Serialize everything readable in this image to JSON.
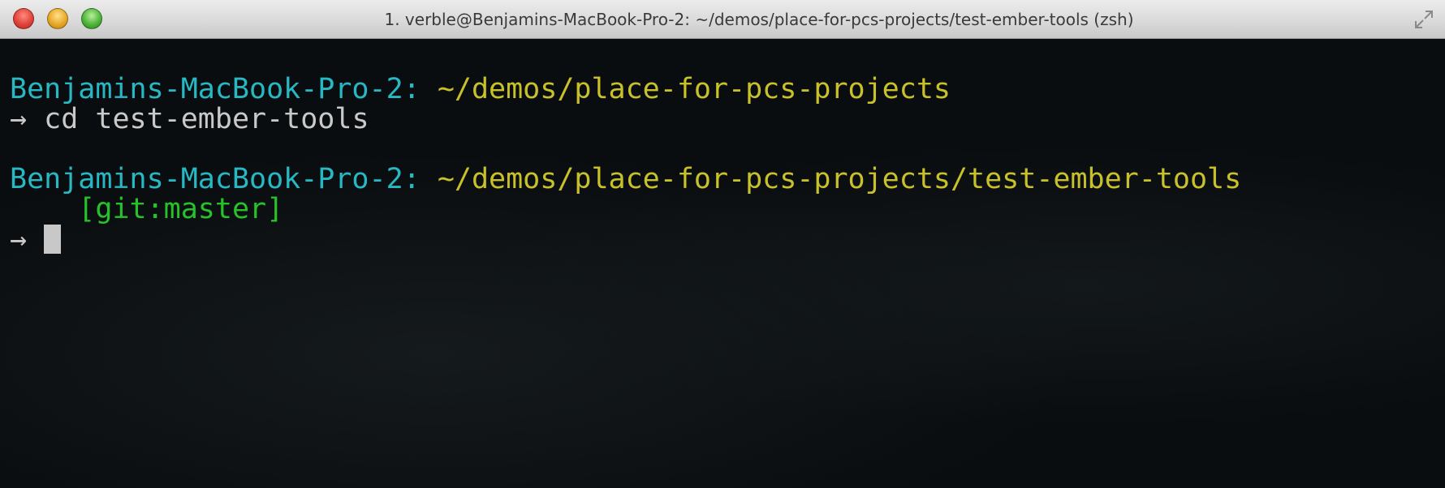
{
  "window": {
    "title": "1. verble@Benjamins-MacBook-Pro-2: ~/demos/place-for-pcs-projects/test-ember-tools (zsh)"
  },
  "terminal": {
    "block1": {
      "host": "Benjamins-MacBook-Pro-2:",
      "path": "~/demos/place-for-pcs-projects",
      "arrow": "→",
      "command": "cd test-ember-tools"
    },
    "block2": {
      "host": "Benjamins-MacBook-Pro-2:",
      "path": "~/demos/place-for-pcs-projects/test-ember-tools",
      "git_branch": "[git:master]",
      "arrow": "→",
      "command": ""
    }
  },
  "colors": {
    "host": "#27b8c4",
    "path": "#c8c12a",
    "git": "#27c12a",
    "text": "#c9c9c9",
    "background": "#0a0d0f"
  }
}
